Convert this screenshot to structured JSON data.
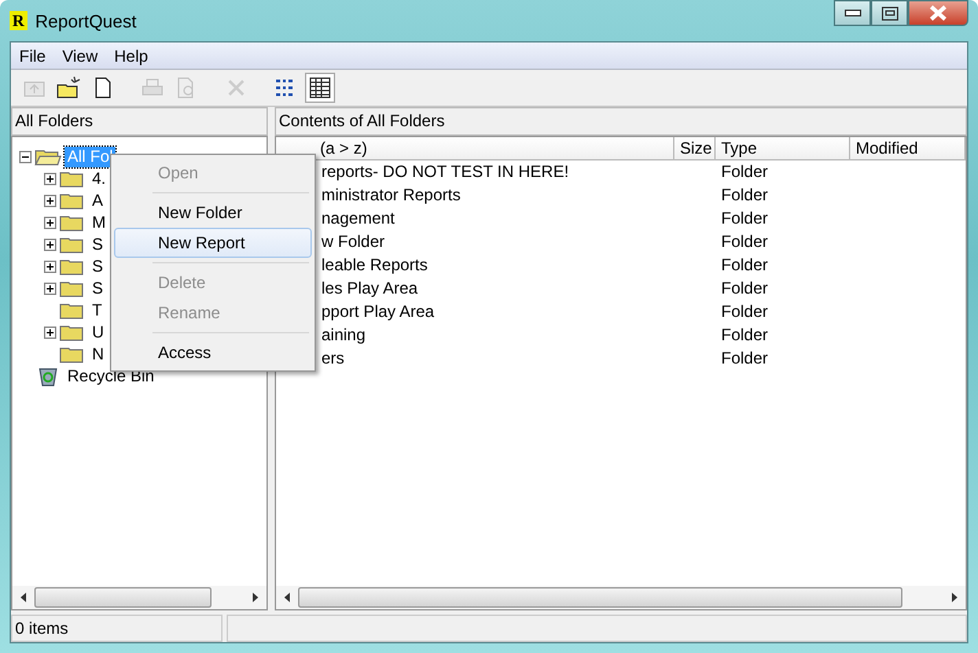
{
  "window": {
    "title": "ReportQuest",
    "icon_letter": "R"
  },
  "menu_bar": [
    "File",
    "View",
    "Help"
  ],
  "toolbar": [
    {
      "kind": "up-folder",
      "disabled": true,
      "selected": false
    },
    {
      "kind": "new-folder",
      "disabled": false,
      "selected": false
    },
    {
      "kind": "new-document",
      "disabled": false,
      "selected": false
    },
    {
      "kind": "print",
      "disabled": true,
      "selected": false
    },
    {
      "kind": "preview",
      "disabled": true,
      "selected": false
    },
    {
      "kind": "delete",
      "disabled": true,
      "selected": false
    },
    {
      "kind": "list-view",
      "disabled": false,
      "selected": false
    },
    {
      "kind": "details-view",
      "disabled": false,
      "selected": true
    }
  ],
  "left_pane": {
    "header": "All Folders",
    "tree": [
      {
        "label": "All Fol",
        "kind": "folder",
        "expanded": true,
        "selected": true,
        "children": [
          {
            "label": "4.",
            "kind": "folder",
            "has_children": true,
            "selected": false
          },
          {
            "label": "A",
            "kind": "folder",
            "has_children": true,
            "selected": false
          },
          {
            "label": "M",
            "kind": "folder",
            "has_children": true,
            "selected": false
          },
          {
            "label": "S",
            "kind": "folder",
            "has_children": true,
            "selected": false
          },
          {
            "label": "S",
            "kind": "folder",
            "has_children": true,
            "selected": false
          },
          {
            "label": "S",
            "kind": "folder",
            "has_children": true,
            "selected": false
          },
          {
            "label": "T",
            "kind": "folder",
            "has_children": false,
            "selected": false
          },
          {
            "label": "U",
            "kind": "folder",
            "has_children": true,
            "selected": false
          },
          {
            "label": "N",
            "kind": "folder",
            "has_children": false,
            "selected": false
          }
        ]
      },
      {
        "label": "Recycle Bin",
        "kind": "recycle-bin",
        "selected": false
      }
    ]
  },
  "right_pane": {
    "header": "Contents of All Folders",
    "columns": [
      "(a > z)",
      "Size",
      "Type",
      "Modified"
    ],
    "rows": [
      {
        "name": "reports- DO NOT TEST IN HERE!",
        "type": "Folder"
      },
      {
        "name": "ministrator Reports",
        "type": "Folder"
      },
      {
        "name": "nagement",
        "type": "Folder"
      },
      {
        "name": "w Folder",
        "type": "Folder"
      },
      {
        "name": "leable Reports",
        "type": "Folder"
      },
      {
        "name": "les Play Area",
        "type": "Folder"
      },
      {
        "name": "pport Play Area",
        "type": "Folder"
      },
      {
        "name": "aining",
        "type": "Folder"
      },
      {
        "name": "ers",
        "type": "Folder"
      }
    ]
  },
  "context_menu": [
    {
      "kind": "item",
      "label": "Open",
      "disabled": true,
      "selected": false
    },
    {
      "kind": "separator"
    },
    {
      "kind": "item",
      "label": "New Folder",
      "disabled": false,
      "selected": false
    },
    {
      "kind": "item",
      "label": "New Report",
      "disabled": false,
      "selected": true
    },
    {
      "kind": "separator"
    },
    {
      "kind": "item",
      "label": "Delete",
      "disabled": true,
      "selected": false
    },
    {
      "kind": "item",
      "label": "Rename",
      "disabled": true,
      "selected": false
    },
    {
      "kind": "separator"
    },
    {
      "kind": "item",
      "label": "Access",
      "disabled": false,
      "selected": false
    }
  ],
  "status_bar": {
    "text": "0 items"
  }
}
